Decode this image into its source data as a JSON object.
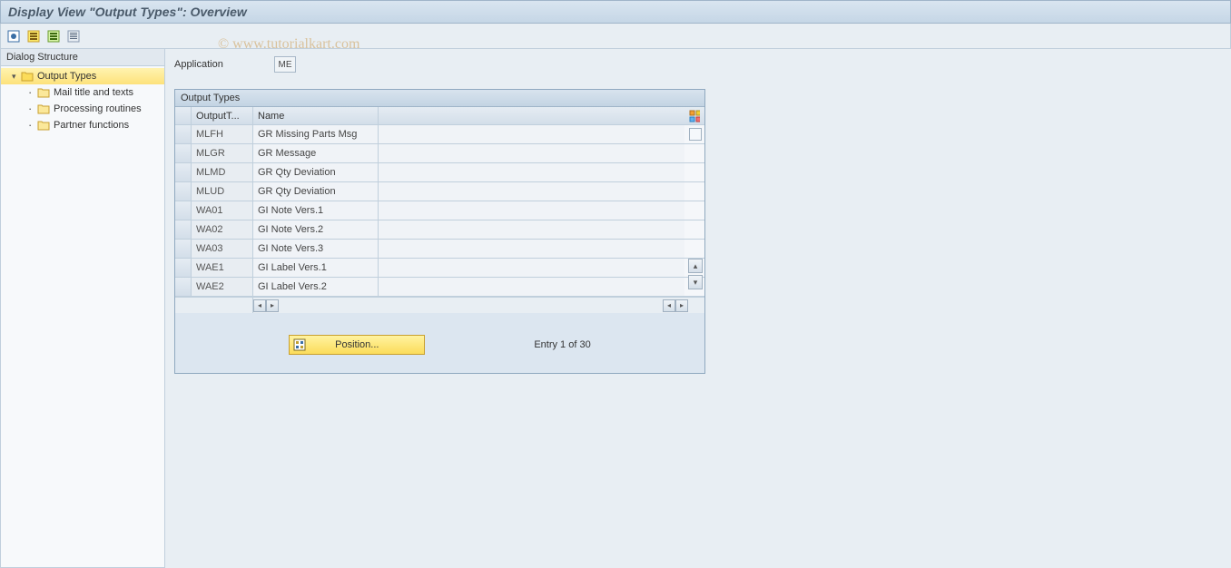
{
  "title": "Display View \"Output Types\": Overview",
  "watermark": "© www.tutorialkart.com",
  "sidebar": {
    "header": "Dialog Structure",
    "root": {
      "label": "Output Types"
    },
    "children": [
      {
        "label": "Mail title and texts"
      },
      {
        "label": "Processing routines"
      },
      {
        "label": "Partner functions"
      }
    ]
  },
  "field": {
    "label": "Application",
    "value": "ME"
  },
  "table": {
    "title": "Output Types",
    "columns": {
      "code": "OutputT...",
      "name": "Name"
    },
    "rows": [
      {
        "code": "MLFH",
        "name": "GR Missing Parts Msg"
      },
      {
        "code": "MLGR",
        "name": "GR Message"
      },
      {
        "code": "MLMD",
        "name": "GR Qty Deviation"
      },
      {
        "code": "MLUD",
        "name": "GR Qty Deviation"
      },
      {
        "code": "WA01",
        "name": "GI Note Vers.1"
      },
      {
        "code": "WA02",
        "name": "GI Note Vers.2"
      },
      {
        "code": "WA03",
        "name": "GI Note Vers.3"
      },
      {
        "code": "WAE1",
        "name": "GI Label Vers.1"
      },
      {
        "code": "WAE2",
        "name": "GI Label Vers.2"
      }
    ]
  },
  "footer": {
    "position_label": "Position...",
    "entry_text": "Entry 1 of 30"
  }
}
